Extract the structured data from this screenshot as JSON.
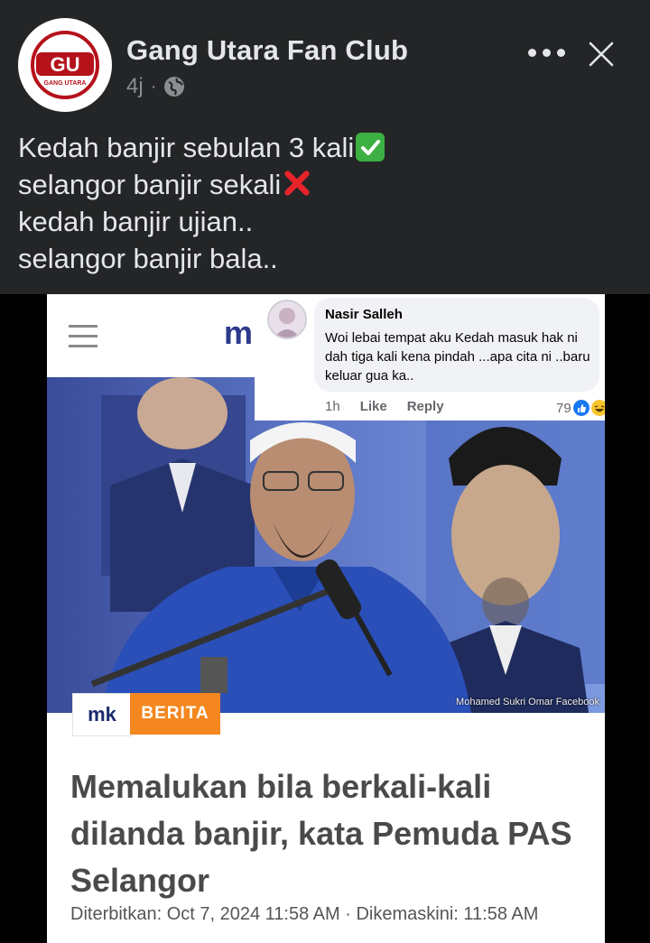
{
  "post": {
    "page_name": "Gang Utara Fan Club",
    "time": "4j",
    "separator": "·",
    "avatar_logo": {
      "letters": "GU",
      "caption": "GANG UTARA"
    },
    "lines": [
      "Kedah banjir sebulan 3 kali",
      "selangor banjir sekali",
      "kedah banjir ujian..",
      "selangor banjir bala.."
    ],
    "icons": {
      "privacy": "globe-icon",
      "more": "more-options-icon",
      "close": "close-icon",
      "line1": "check-mark-emoji",
      "line2": "cross-mark-emoji"
    }
  },
  "shared_image": {
    "site_logo": "m",
    "comment": {
      "name": "Nasir Salleh",
      "text": "Woi lebai tempat aku Kedah masuk hak ni dah tiga kali kena pindah ...apa cita ni ..baru keluar gua ka..",
      "time": "1h",
      "like": "Like",
      "reply": "Reply",
      "reaction_count": "79"
    },
    "photo_credit": "Mohamed Sukri Omar Facebook",
    "badge_logo": "mk",
    "badge_category": "BERITA",
    "headline": "Memalukan bila berkali-kali dilanda banjir, kata Pemuda PAS Selangor",
    "published": "Diterbitkan:  Oct 7, 2024 11:58 AM · Dikemaskini: 11:58 AM"
  },
  "colors": {
    "post_bg": "#242526",
    "text": "#e4e6eb",
    "muted": "#8a8d91",
    "accent_orange": "#f4871f",
    "site_blue": "#2d3a8c"
  }
}
